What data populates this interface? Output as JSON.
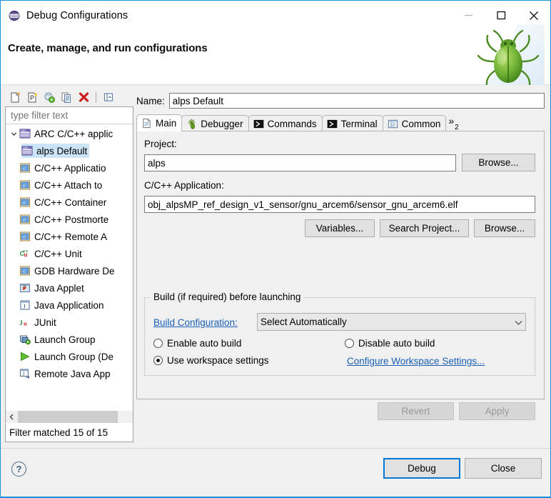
{
  "window": {
    "title": "Debug Configurations",
    "icon": "eclipse-debug-icon",
    "minimize_label": "—",
    "maximize_label": "☐",
    "close_label": "✕"
  },
  "header": {
    "title": "Create, manage, and run configurations",
    "decoration_icon": "green-bug-icon"
  },
  "tree_toolbar": {
    "items": [
      {
        "name": "new-launch-configuration-icon",
        "label": "New launch configuration"
      },
      {
        "name": "new-prototype-icon",
        "label": "New prototype"
      },
      {
        "name": "export-launch-configuration-icon",
        "label": "Export"
      },
      {
        "name": "duplicate-icon",
        "label": "Duplicate"
      },
      {
        "name": "delete-icon",
        "label": "Delete"
      },
      {
        "name": "collapse-all-icon",
        "label": "Collapse All"
      }
    ]
  },
  "filter": {
    "placeholder": "type filter text",
    "value": "",
    "status": "Filter matched 15 of 15"
  },
  "tree": {
    "items": [
      {
        "label": "ARC C/C++ applic",
        "icon": "arc-icon",
        "level": 0,
        "expanded": true,
        "selected": false
      },
      {
        "label": "alps Default",
        "icon": "arc-icon",
        "level": 1,
        "expanded": false,
        "selected": true
      },
      {
        "label": "C/C++ Applicatio",
        "icon": "c-app-icon",
        "level": 0,
        "expanded": false,
        "selected": false
      },
      {
        "label": "C/C++ Attach to ",
        "icon": "c-app-icon",
        "level": 0,
        "expanded": false,
        "selected": false
      },
      {
        "label": "C/C++ Container",
        "icon": "c-app-icon",
        "level": 0,
        "expanded": false,
        "selected": false
      },
      {
        "label": "C/C++ Postmorte",
        "icon": "c-app-icon",
        "level": 0,
        "expanded": false,
        "selected": false
      },
      {
        "label": "C/C++ Remote A",
        "icon": "c-app-icon",
        "level": 0,
        "expanded": false,
        "selected": false
      },
      {
        "label": "C/C++ Unit",
        "icon": "cunit-icon",
        "level": 0,
        "expanded": false,
        "selected": false
      },
      {
        "label": "GDB Hardware De",
        "icon": "c-app-icon",
        "level": 0,
        "expanded": false,
        "selected": false
      },
      {
        "label": "Java Applet",
        "icon": "java-applet-icon",
        "level": 0,
        "expanded": false,
        "selected": false
      },
      {
        "label": "Java Application",
        "icon": "java-app-icon",
        "level": 0,
        "expanded": false,
        "selected": false
      },
      {
        "label": "JUnit",
        "icon": "junit-icon",
        "level": 0,
        "expanded": false,
        "selected": false
      },
      {
        "label": "Launch Group",
        "icon": "launch-group-icon",
        "level": 0,
        "expanded": false,
        "selected": false
      },
      {
        "label": "Launch Group (De",
        "icon": "launch-group-deprecated-icon",
        "level": 0,
        "expanded": false,
        "selected": false
      },
      {
        "label": "Remote Java App",
        "icon": "remote-java-app-icon",
        "level": 0,
        "expanded": false,
        "selected": false
      }
    ]
  },
  "config": {
    "name_label": "Name:",
    "name_value": "alps Default",
    "tabs": [
      {
        "label": "Main",
        "icon": "document-icon",
        "active": true
      },
      {
        "label": "Debugger",
        "icon": "bug-gear-icon",
        "active": false
      },
      {
        "label": "Commands",
        "icon": "console-icon",
        "active": false
      },
      {
        "label": "Terminal",
        "icon": "console-icon",
        "active": false
      },
      {
        "label": "Common",
        "icon": "common-icon",
        "active": false
      }
    ],
    "tab_overflow_label": "»",
    "tab_overflow_count": "2",
    "project_label": "Project:",
    "project_value": "alps",
    "project_browse_label": "Browse...",
    "application_label": "C/C++ Application:",
    "application_value": "obj_alpsMP_ref_design_v1_sensor/gnu_arcem6/sensor_gnu_arcem6.elf",
    "variables_label": "Variables...",
    "search_project_label": "Search Project...",
    "app_browse_label": "Browse...",
    "build_group_title": "Build (if required) before launching",
    "build_configuration_label": "Build Configuration:",
    "build_configuration_value": "Select Automatically",
    "build_configuration_options": [
      "Select Automatically"
    ],
    "radio_enable_auto_build": "Enable auto build",
    "radio_disable_auto_build": "Disable auto build",
    "radio_use_workspace_settings": "Use workspace settings",
    "configure_workspace_link": "Configure Workspace Settings...",
    "selected_build_radio": "use_workspace_settings",
    "revert_label": "Revert",
    "revert_enabled": false,
    "apply_label": "Apply",
    "apply_enabled": false
  },
  "footer": {
    "help_label": "?",
    "debug_label": "Debug",
    "close_label": "Close"
  },
  "colors": {
    "accent": "#0078d7",
    "window_border": "#1a8fe0",
    "selection": "#cce4f7",
    "link": "#1a5fb4",
    "panel_bg": "#f0f0f0"
  }
}
